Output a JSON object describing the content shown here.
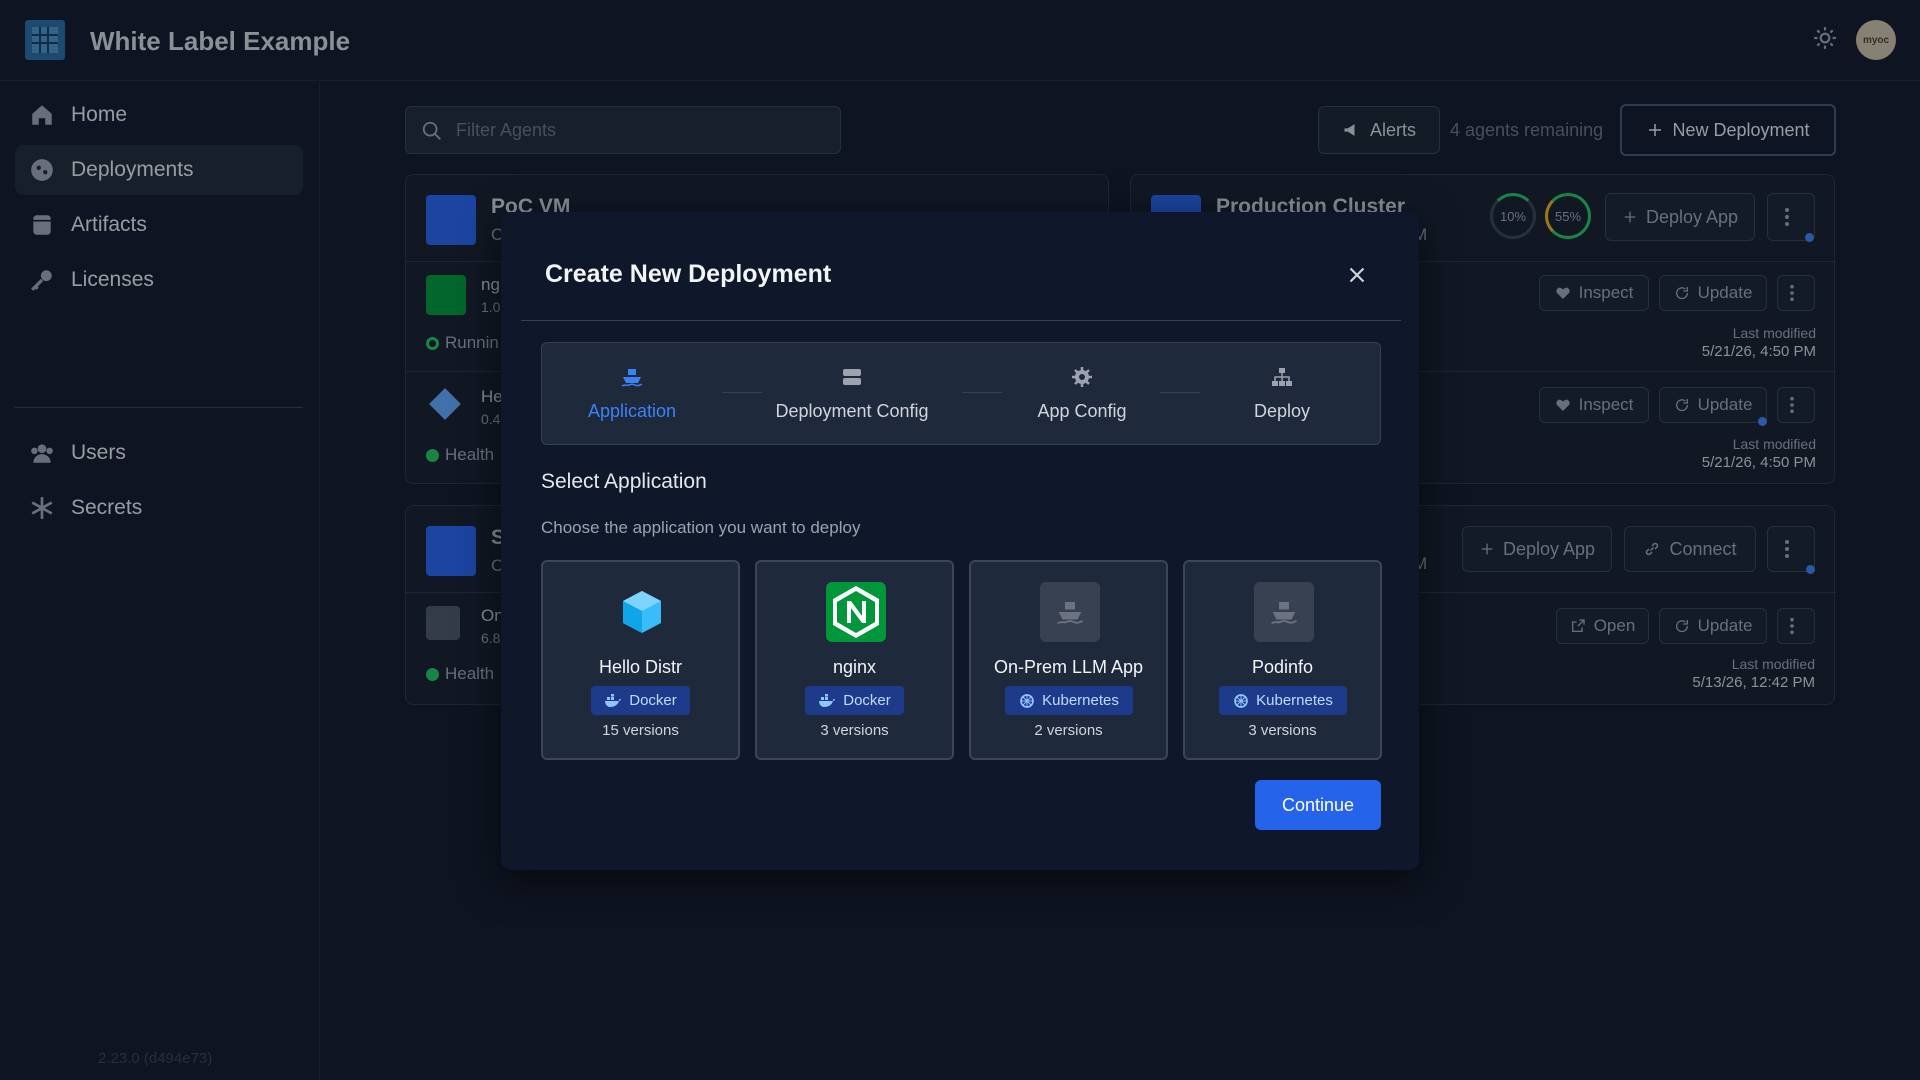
{
  "app": {
    "title": "White Label Example",
    "avatar_text": "myoc"
  },
  "sidebar": {
    "items": [
      {
        "label": "Home",
        "icon": "home-icon"
      },
      {
        "label": "Deployments",
        "icon": "deployments-icon"
      },
      {
        "label": "Artifacts",
        "icon": "artifacts-icon"
      },
      {
        "label": "Licenses",
        "icon": "key-icon"
      },
      {
        "label": "Users",
        "icon": "users-icon"
      },
      {
        "label": "Secrets",
        "icon": "asterisk-icon"
      }
    ],
    "version": "2.23.0 (d494e73)"
  },
  "toolbar": {
    "filter_placeholder": "Filter Agents",
    "alerts_label": "Alerts",
    "remaining": "4 agents remaining",
    "new_deployment_label": "New Deployment"
  },
  "background": {
    "poc_title": "PoC VM",
    "poc_sub": "C",
    "nginx_name": "ng",
    "nginx_ver": "1.0",
    "nginx_status": "Runnin",
    "hello_name": "He",
    "hello_ver": "0.4",
    "hello_status": "Health",
    "prod_title": "Production Cluster",
    "prod_sub": "M",
    "cpu": "10%",
    "mem": "55%",
    "deploy_app": "Deploy App",
    "inspect": "Inspect",
    "update": "Update",
    "last_modified": "Last modified",
    "modified_1": "5/21/26, 4:50 PM",
    "modified_2": "5/21/26, 4:50 PM",
    "third_title": "S",
    "third_sub": "C",
    "third_right": "M",
    "connect": "Connect",
    "onprem_name": "On",
    "onprem_ver": "6.8",
    "onprem_status": "Health",
    "open": "Open",
    "modified_3": "5/13/26, 12:42 PM"
  },
  "modal": {
    "title": "Create New Deployment",
    "steps": [
      {
        "label": "Application",
        "icon": "ship-icon",
        "active": true
      },
      {
        "label": "Deployment Config",
        "icon": "server-icon",
        "active": false
      },
      {
        "label": "App Config",
        "icon": "gear-icon",
        "active": false
      },
      {
        "label": "Deploy",
        "icon": "network-icon",
        "active": false
      }
    ],
    "section_title": "Select Application",
    "section_sub": "Choose the application you want to deploy",
    "apps": [
      {
        "name": "Hello Distr",
        "platform": "Docker",
        "versions": "15 versions"
      },
      {
        "name": "nginx",
        "platform": "Docker",
        "versions": "3 versions"
      },
      {
        "name": "On-Prem LLM App",
        "platform": "Kubernetes",
        "versions": "2 versions"
      },
      {
        "name": "Podinfo",
        "platform": "Kubernetes",
        "versions": "3 versions"
      }
    ],
    "continue_label": "Continue"
  },
  "colors": {
    "accent": "#2563eb",
    "badge_bg": "#1e3a8a",
    "healthy": "#22c55e",
    "nginx": "#009639"
  }
}
